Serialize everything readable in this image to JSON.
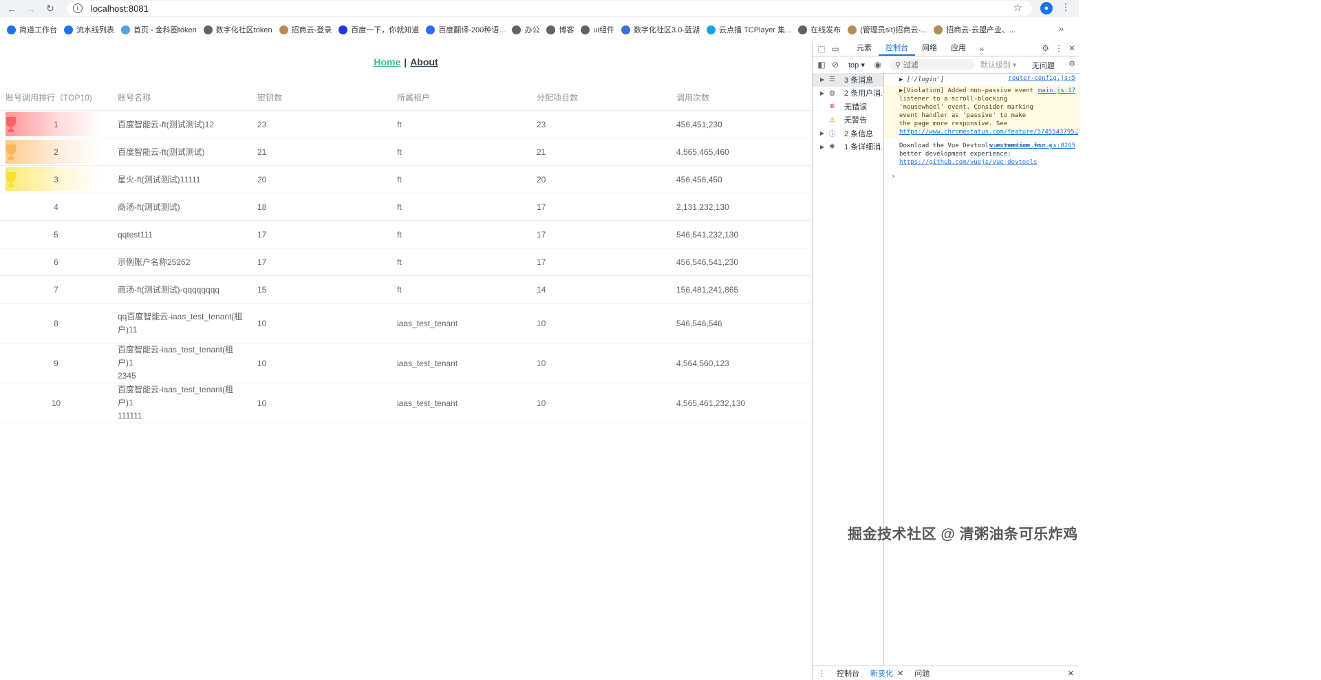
{
  "browser": {
    "url": "localhost:8081",
    "bookmarks": [
      {
        "label": "简道工作台",
        "color": "#1a73e8"
      },
      {
        "label": "流水线列表",
        "color": "#1a73e8"
      },
      {
        "label": "首页 - 金科圈token",
        "color": "#4fa3e0"
      },
      {
        "label": "数字化社区token",
        "color": "#5f6368"
      },
      {
        "label": "招商云-登录",
        "color": "#b08d57"
      },
      {
        "label": "百度一下，你就知道",
        "color": "#2932e1"
      },
      {
        "label": "百度翻译-200种语...",
        "color": "#2f6cf5"
      },
      {
        "label": "办公",
        "color": "#5f6368"
      },
      {
        "label": "博客",
        "color": "#5f6368"
      },
      {
        "label": "ui组件",
        "color": "#5f6368"
      },
      {
        "label": "数字化社区3.0-蓝湖",
        "color": "#3a6fe0"
      },
      {
        "label": "云点播 TCPlayer 集...",
        "color": "#1ba1e2"
      },
      {
        "label": "在线发布",
        "color": "#5f6368"
      },
      {
        "label": "(管理员sit)招商云-...",
        "color": "#b08d57"
      },
      {
        "label": "招商云-云盟产业、...",
        "color": "#b08d57"
      }
    ]
  },
  "nav": {
    "home": "Home",
    "sep": "|",
    "about": "About"
  },
  "table": {
    "headers": [
      "账号调用排行（TOP10)",
      "账号名称",
      "密钥数",
      "所属租户",
      "分配项目数",
      "调用次数"
    ],
    "rows": [
      {
        "rank": "1",
        "name": "百度智能云-ft(测试测试)12",
        "keys": "23",
        "tenant": "ft",
        "projects": "23",
        "calls": "456,451,230"
      },
      {
        "rank": "2",
        "name": "百度智能云-ft(测试测试)",
        "keys": "21",
        "tenant": "ft",
        "projects": "21",
        "calls": "4,565,465,460"
      },
      {
        "rank": "3",
        "name": "星火-ft(测试测试)11111",
        "keys": "20",
        "tenant": "ft",
        "projects": "20",
        "calls": "456,456,450"
      },
      {
        "rank": "4",
        "name": "商汤-ft(测试测试)",
        "keys": "18",
        "tenant": "ft",
        "projects": "17",
        "calls": "2,131,232,130"
      },
      {
        "rank": "5",
        "name": "qqtest111",
        "keys": "17",
        "tenant": "ft",
        "projects": "17",
        "calls": "546,541,232,130"
      },
      {
        "rank": "6",
        "name": "示例账户名称25262",
        "keys": "17",
        "tenant": "ft",
        "projects": "17",
        "calls": "456,546,541,230"
      },
      {
        "rank": "7",
        "name": "商汤-ft(测试测试)-qqqqqqqq",
        "keys": "15",
        "tenant": "ft",
        "projects": "14",
        "calls": "156,481,241,865"
      },
      {
        "rank": "8",
        "name_l1": "qq百度智能云-iaas_test_tenant(租",
        "name_l2": "户)11",
        "keys": "10",
        "tenant": "iaas_test_tenant",
        "projects": "10",
        "calls": "546,546,546"
      },
      {
        "rank": "9",
        "name_l1": "百度智能云-iaas_test_tenant(租户)1",
        "name_l2": "2345",
        "keys": "10",
        "tenant": "iaas_test_tenant",
        "projects": "10",
        "calls": "4,564,560,123"
      },
      {
        "rank": "10",
        "name_l1": "百度智能云-iaas_test_tenant(租户)1",
        "name_l2": "111111",
        "keys": "10",
        "tenant": "iaas_test_tenant",
        "projects": "10",
        "calls": "4,565,461,232,130"
      }
    ],
    "top_colors": [
      "#ff4d4f",
      "#ffa940",
      "#fadb14"
    ]
  },
  "devtools": {
    "tabs": [
      "元素",
      "控制台",
      "网络",
      "应用"
    ],
    "active_tab": "控制台",
    "context": "top",
    "filter_placeholder": "过滤",
    "level": "默认级别",
    "no_issues": "无问题",
    "sidebar": [
      {
        "label": "3 条消息",
        "icon": "list-icon",
        "arrow": true
      },
      {
        "label": "2 条用户消...",
        "icon": "user-icon",
        "arrow": true
      },
      {
        "label": "无错误",
        "icon": "error-icon",
        "arrow": false
      },
      {
        "label": "无警告",
        "icon": "warning-icon",
        "arrow": false
      },
      {
        "label": "2 条信息",
        "icon": "info-icon",
        "arrow": true
      },
      {
        "label": "1 条详细消...",
        "icon": "bug-icon",
        "arrow": true
      }
    ],
    "console": {
      "line1": "▶ ['/login']",
      "line1_src": "router-config.js:5",
      "warn_text": "▶[Violation] Added non-passive event listener to a scroll-blocking 'mousewheel' event. Consider marking event handler as 'passive' to make the page more responsive. See",
      "warn_src": "main.js:17",
      "warn_link": "https://www.chromestatus.com/feature/5745543795…",
      "vue_text": "Download the Vue Devtools extension for a better development experience:",
      "vue_src": "vue.runtime.esm.js:8265",
      "vue_link": "https://github.com/vuejs/vue-devtools",
      "prompt": "›"
    },
    "bottom_tabs": [
      "控制台",
      "新变化",
      "问题"
    ],
    "bottom_close": "✕"
  },
  "watermark": "掘金技术社区 @ 清粥油条可乐炸鸡"
}
